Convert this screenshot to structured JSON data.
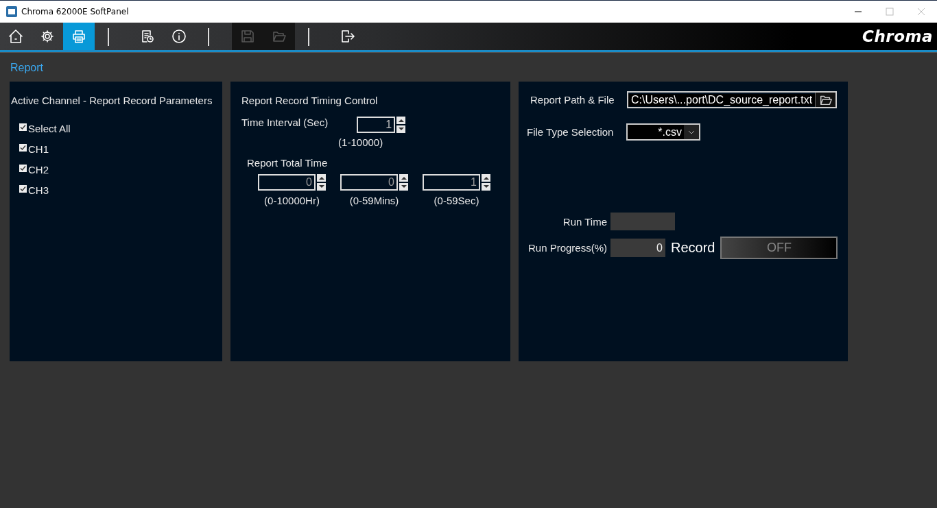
{
  "window": {
    "title": "Chroma 62000E SoftPanel"
  },
  "toolbar": [
    {
      "kind": "home",
      "selected": false,
      "disabled": false
    },
    {
      "kind": "gear",
      "selected": false,
      "disabled": false
    },
    {
      "kind": "printer",
      "selected": true,
      "disabled": false
    },
    {
      "kind": "separator"
    },
    {
      "kind": "report",
      "selected": false,
      "disabled": false
    },
    {
      "kind": "info",
      "selected": false,
      "disabled": false
    },
    {
      "kind": "separator"
    },
    {
      "kind": "save",
      "selected": false,
      "disabled": true
    },
    {
      "kind": "open",
      "selected": false,
      "disabled": true
    },
    {
      "kind": "separator"
    },
    {
      "kind": "exit",
      "selected": false,
      "disabled": false
    }
  ],
  "logo": "Chroma",
  "page_title": "Report",
  "channels_panel": {
    "title": "Active Channel - Report Record Parameters",
    "items": [
      {
        "label": "Select All",
        "checked": true
      },
      {
        "label": "CH1",
        "checked": true
      },
      {
        "label": "CH2",
        "checked": true
      },
      {
        "label": "CH3",
        "checked": true
      }
    ]
  },
  "timing_panel": {
    "title": "Report Record Timing Control",
    "interval": {
      "label": "Time Interval (Sec)",
      "value": "1",
      "range": "(1-10000)"
    },
    "total_time": {
      "label": "Report Total Time",
      "fields": [
        {
          "value": "0",
          "range": "(0-10000Hr)"
        },
        {
          "value": "0",
          "range": "(0-59Mins)"
        },
        {
          "value": "1",
          "range": "(0-59Sec)"
        }
      ]
    }
  },
  "file_panel": {
    "path": {
      "label": "Report Path & File",
      "value": "C:\\Users\\...port\\DC_source_report.txt"
    },
    "file_type": {
      "label": "File Type Selection",
      "value": "*.csv"
    },
    "run_time": {
      "label": "Run Time"
    },
    "run_progress": {
      "label": "Run Progress(%)",
      "value": "0"
    },
    "record": {
      "label": "Record",
      "button": "OFF",
      "on": false
    }
  }
}
